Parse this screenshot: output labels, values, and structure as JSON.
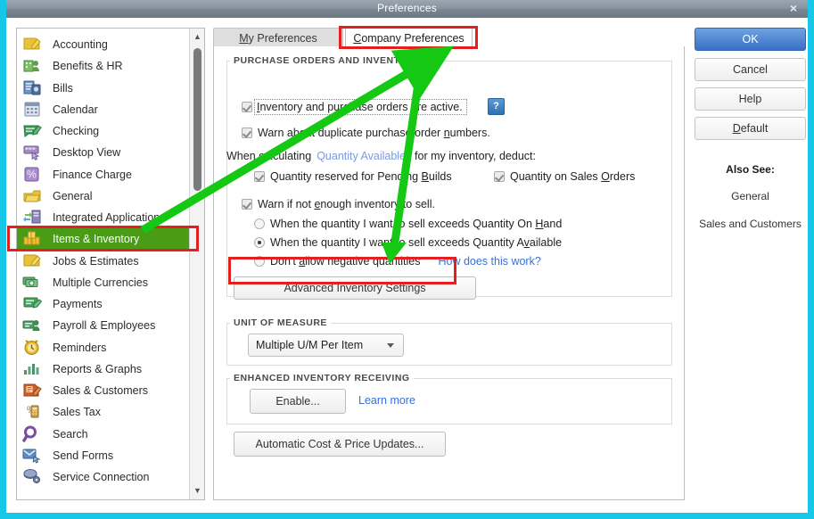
{
  "window": {
    "title": "Preferences",
    "close_label": "×"
  },
  "sidebar": {
    "items": [
      {
        "label": "Accounting",
        "icon": "accounting-icon",
        "selected": false
      },
      {
        "label": "Benefits & HR",
        "icon": "benefits-hr-icon",
        "selected": false
      },
      {
        "label": "Bills",
        "icon": "bills-icon",
        "selected": false
      },
      {
        "label": "Calendar",
        "icon": "calendar-icon",
        "selected": false
      },
      {
        "label": "Checking",
        "icon": "checking-icon",
        "selected": false
      },
      {
        "label": "Desktop View",
        "icon": "desktop-view-icon",
        "selected": false
      },
      {
        "label": "Finance Charge",
        "icon": "finance-charge-icon",
        "selected": false
      },
      {
        "label": "General",
        "icon": "general-icon",
        "selected": false
      },
      {
        "label": "Integrated Applications",
        "icon": "integrated-applications-icon",
        "selected": false
      },
      {
        "label": "Items & Inventory",
        "icon": "items-inventory-icon",
        "selected": true
      },
      {
        "label": "Jobs & Estimates",
        "icon": "jobs-estimates-icon",
        "selected": false
      },
      {
        "label": "Multiple Currencies",
        "icon": "multiple-currencies-icon",
        "selected": false
      },
      {
        "label": "Payments",
        "icon": "payments-icon",
        "selected": false
      },
      {
        "label": "Payroll & Employees",
        "icon": "payroll-employees-icon",
        "selected": false
      },
      {
        "label": "Reminders",
        "icon": "reminders-icon",
        "selected": false
      },
      {
        "label": "Reports & Graphs",
        "icon": "reports-graphs-icon",
        "selected": false
      },
      {
        "label": "Sales & Customers",
        "icon": "sales-customers-icon",
        "selected": false
      },
      {
        "label": "Sales Tax",
        "icon": "sales-tax-icon",
        "selected": false
      },
      {
        "label": "Search",
        "icon": "search-icon",
        "selected": false
      },
      {
        "label": "Send Forms",
        "icon": "send-forms-icon",
        "selected": false
      },
      {
        "label": "Service Connection",
        "icon": "service-connection-icon",
        "selected": false
      }
    ],
    "scroll_up": "▲",
    "scroll_down": "▼"
  },
  "tabs": [
    {
      "label": "My Preferences",
      "active": false
    },
    {
      "label": "Company Preferences",
      "active": true
    }
  ],
  "purchase_orders": {
    "group_title": "PURCHASE ORDERS AND INVENTORY",
    "inventory_active": "Inventory and purchase orders are active.",
    "help_badge": "?",
    "warn_duplicate": "Warn about duplicate purchase order numbers.",
    "when_calculating_prefix": "When calculating",
    "quantity_available_link": "Quantity Available",
    "when_calculating_suffix": "for my inventory, deduct:",
    "pending_builds": "Quantity reserved for Pending Builds",
    "sales_orders": "Quantity on Sales Orders",
    "warn_not_enough": "Warn if not enough inventory to sell.",
    "radio_on_hand": "When the quantity I want to sell exceeds Quantity On Hand",
    "radio_available": "When the quantity I want to sell exceeds Quantity Available",
    "radio_negative": "Don't allow negative quantities",
    "how_does_this_work": "How does this work?",
    "advanced_button": "Advanced Inventory Settings"
  },
  "unit_of_measure": {
    "group_title": "UNIT OF MEASURE",
    "selected": "Multiple U/M Per Item"
  },
  "enhanced_receiving": {
    "group_title": "ENHANCED INVENTORY RECEIVING",
    "enable_button": "Enable...",
    "learn_more": "Learn more"
  },
  "automatic_updates_button": "Automatic Cost & Price Updates...",
  "right_buttons": [
    {
      "label": "OK",
      "style": "primary"
    },
    {
      "label": "Cancel",
      "style": "normal"
    },
    {
      "label": "Help",
      "style": "normal"
    },
    {
      "label": "Default",
      "style": "normal"
    }
  ],
  "also_see": {
    "header": "Also See:",
    "links": [
      "General",
      "Sales and Customers"
    ]
  },
  "annotations": {
    "highlight_color": "#e41f1f",
    "arrow_color": "#14c814",
    "boxes": [
      "sidebar-items-inventory",
      "company-preferences-tab",
      "advanced-inventory-settings-button"
    ],
    "arrows": [
      "sidebar-to-tab-arrow",
      "tab-to-advanced-button-arrow"
    ]
  },
  "colors": {
    "frame": "#16c7e8",
    "selected_item": "#4a9b16",
    "link": "#3a6fd8",
    "primary_button": "#3a6fc4"
  }
}
